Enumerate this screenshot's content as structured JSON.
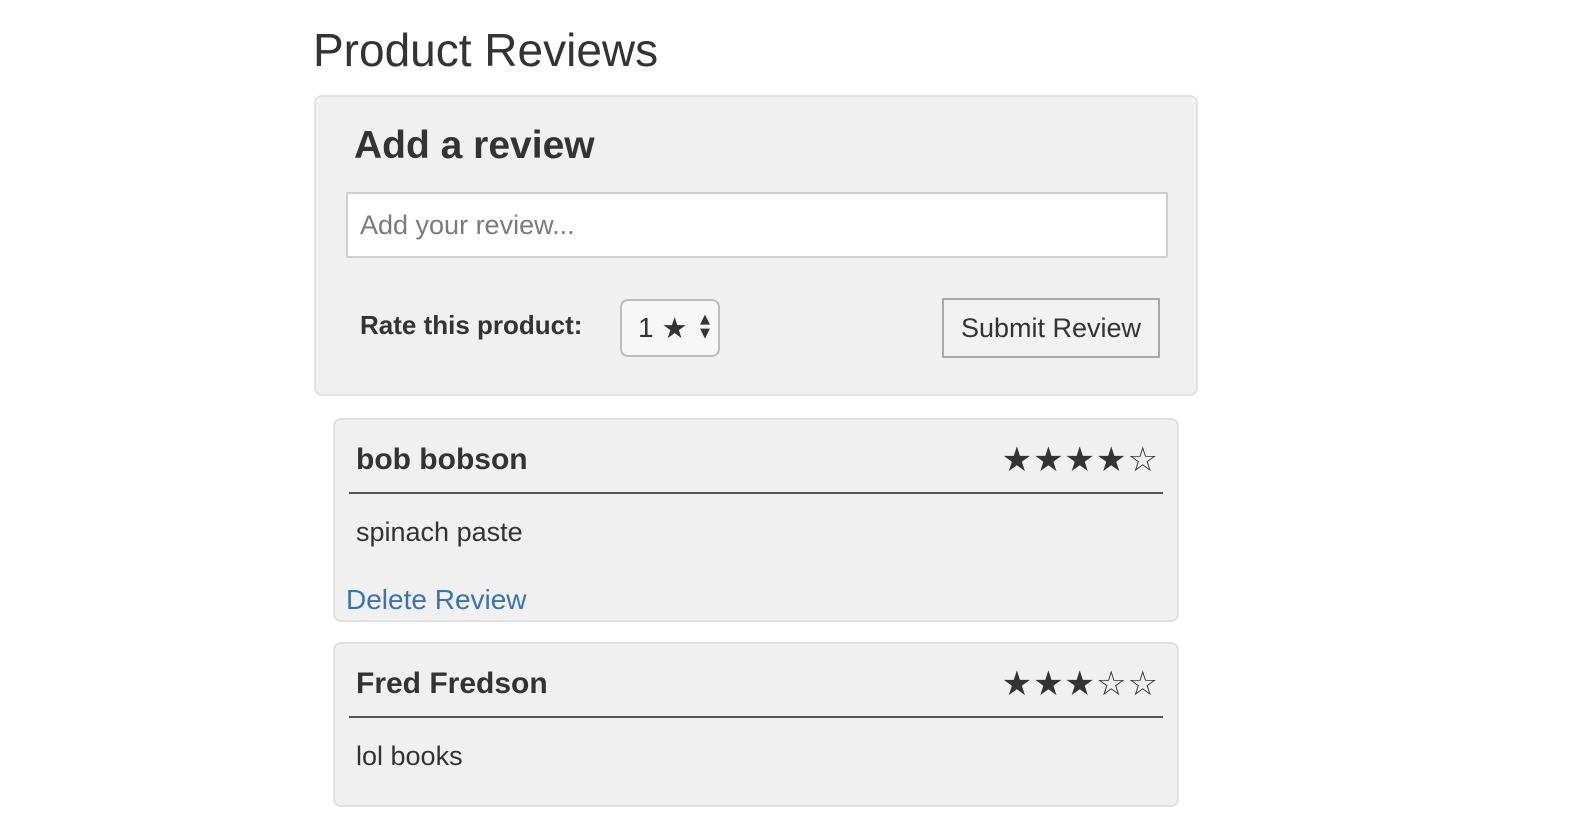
{
  "page": {
    "title": "Product Reviews"
  },
  "add_review": {
    "title": "Add a review",
    "placeholder": "Add your review...",
    "value": "",
    "rate_label": "Rate this product:",
    "rating_select": {
      "value": "1",
      "star": "★"
    },
    "submit_label": "Submit Review"
  },
  "reviews": [
    {
      "author": "bob bobson",
      "stars": "★★★★☆",
      "rating": 4,
      "max_rating": 5,
      "text": "spinach paste",
      "delete_label": "Delete Review"
    },
    {
      "author": "Fred Fredson",
      "stars": "★★★☆☆",
      "rating": 3,
      "max_rating": 5,
      "text": "lol books"
    }
  ],
  "colors": {
    "link": "#3a74b0",
    "panel_bg": "#f0f0f0",
    "text": "#333333"
  }
}
